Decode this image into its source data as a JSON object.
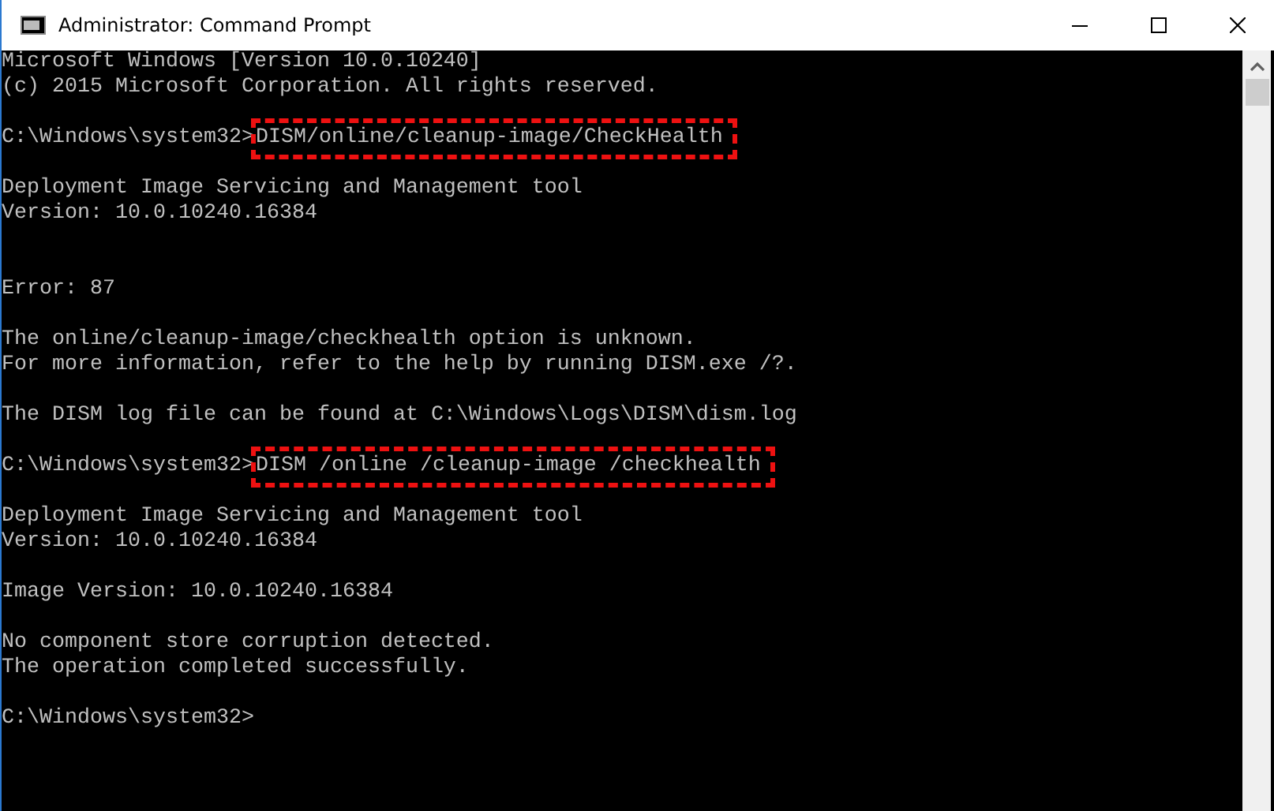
{
  "window": {
    "title": "Administrator: Command Prompt"
  },
  "console": [
    {
      "kind": "text",
      "text": "Microsoft Windows [Version 10.0.10240]"
    },
    {
      "kind": "text",
      "text": "(c) 2015 Microsoft Corporation. All rights reserved."
    },
    {
      "kind": "blank"
    },
    {
      "kind": "command",
      "prompt": "C:\\Windows\\system32>",
      "command": "DISM/online/cleanup-image/CheckHealth",
      "highlighted": true
    },
    {
      "kind": "blank"
    },
    {
      "kind": "text",
      "text": "Deployment Image Servicing and Management tool"
    },
    {
      "kind": "text",
      "text": "Version: 10.0.10240.16384"
    },
    {
      "kind": "blank"
    },
    {
      "kind": "blank"
    },
    {
      "kind": "text",
      "text": "Error: 87"
    },
    {
      "kind": "blank"
    },
    {
      "kind": "text",
      "text": "The online/cleanup-image/checkhealth option is unknown."
    },
    {
      "kind": "text",
      "text": "For more information, refer to the help by running DISM.exe /?."
    },
    {
      "kind": "blank"
    },
    {
      "kind": "text",
      "text": "The DISM log file can be found at C:\\Windows\\Logs\\DISM\\dism.log"
    },
    {
      "kind": "blank"
    },
    {
      "kind": "command",
      "prompt": "C:\\Windows\\system32>",
      "command": "DISM /online /cleanup-image /checkhealth",
      "highlighted": true
    },
    {
      "kind": "blank"
    },
    {
      "kind": "text",
      "text": "Deployment Image Servicing and Management tool"
    },
    {
      "kind": "text",
      "text": "Version: 10.0.10240.16384"
    },
    {
      "kind": "blank"
    },
    {
      "kind": "text",
      "text": "Image Version: 10.0.10240.16384"
    },
    {
      "kind": "blank"
    },
    {
      "kind": "text",
      "text": "No component store corruption detected."
    },
    {
      "kind": "text",
      "text": "The operation completed successfully."
    },
    {
      "kind": "blank"
    },
    {
      "kind": "prompt",
      "prompt": "C:\\Windows\\system32>"
    }
  ]
}
